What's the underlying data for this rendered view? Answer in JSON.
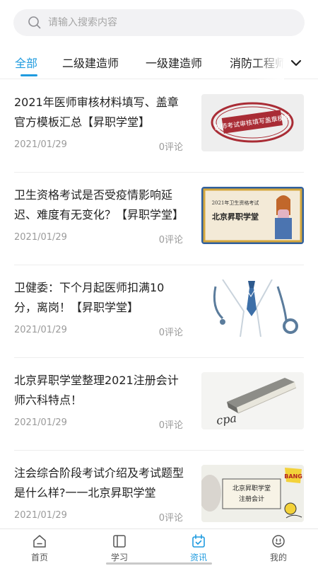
{
  "search": {
    "placeholder": "请输入搜索内容"
  },
  "tabs": {
    "items": [
      {
        "label": "全部",
        "active": true
      },
      {
        "label": "二级建造师",
        "active": false
      },
      {
        "label": "一级建造师",
        "active": false
      },
      {
        "label": "消防工程师",
        "active": false
      }
    ]
  },
  "articles": [
    {
      "title": "2021年医师审核材料填写、盖章官方模板汇总【昇职学堂】",
      "date": "2021/01/29",
      "comments": "0评论",
      "thumb_text": "医师考试审核填写盖章模板"
    },
    {
      "title": "卫生资格考试是否受疫情影响延迟、难度有无变化？【昇职学堂】",
      "date": "2021/01/29",
      "comments": "0评论",
      "thumb_text_1": "2021年卫生资格考试",
      "thumb_text_2": "北京昇职学堂"
    },
    {
      "title": "卫健委：下个月起医师扣满10分，离岗！【昇职学堂】",
      "date": "2021/01/29",
      "comments": "0评论"
    },
    {
      "title": "北京昇职学堂整理2021注册会计师六科特点！",
      "date": "2021/01/29",
      "comments": "0评论",
      "thumb_text": "cpa"
    },
    {
      "title": "注会综合阶段考试介绍及考试题型是什么样?一一北京昇职学堂",
      "date": "2021/01/29",
      "comments": "0评论",
      "thumb_text_1": "北京昇职学堂",
      "thumb_text_2": "注册会计",
      "thumb_text_3": "BANG"
    }
  ],
  "bottom_nav": [
    {
      "label": "首页",
      "icon": "home-icon",
      "active": false
    },
    {
      "label": "学习",
      "icon": "book-icon",
      "active": false
    },
    {
      "label": "资讯",
      "icon": "calendar-news-icon",
      "active": true
    },
    {
      "label": "我的",
      "icon": "smiley-face-icon",
      "active": false
    }
  ],
  "colors": {
    "accent": "#1f9bdf",
    "text": "#222222",
    "muted": "#9a9a9a",
    "search_bg": "#f2f2f4",
    "divider": "#ededed"
  }
}
